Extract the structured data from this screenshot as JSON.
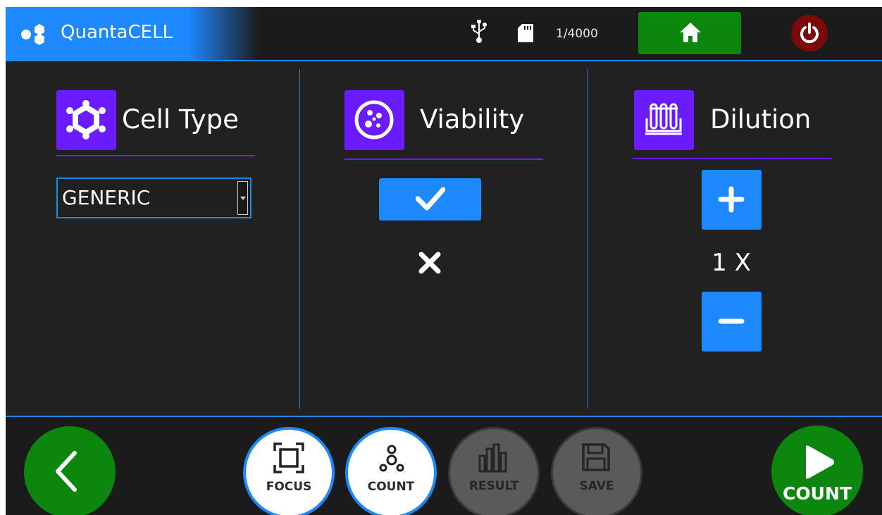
{
  "header": {
    "app_name": "QuantaCELL",
    "storage_count": "1/4000",
    "icons": [
      "logo-icon",
      "usb-icon",
      "sd-card-icon",
      "home-icon",
      "power-icon"
    ]
  },
  "cell_type": {
    "title": "Cell Type",
    "icon": "cell-hexagon-icon",
    "selected": "GENERIC"
  },
  "viability": {
    "title": "Viability",
    "icon": "petri-dish-icon",
    "enabled_icon": "checkmark-icon",
    "disabled_icon": "x-icon"
  },
  "dilution": {
    "title": "Dilution",
    "icon": "test-tubes-icon",
    "value": "1 X"
  },
  "footer": {
    "nav": [
      {
        "label": "FOCUS",
        "icon": "focus-frame-icon",
        "state": "active"
      },
      {
        "label": "COUNT",
        "icon": "cells-icon",
        "state": "active"
      },
      {
        "label": "RESULT",
        "icon": "bar-chart-icon",
        "state": "inactive"
      },
      {
        "label": "SAVE",
        "icon": "floppy-disk-icon",
        "state": "inactive"
      }
    ],
    "start_label": "COUNT"
  },
  "colors": {
    "accent_blue": "#1e88ff",
    "accent_purple": "#6a1cff",
    "green": "#0c860c",
    "power_red": "#7a0909",
    "background": "#212121"
  }
}
